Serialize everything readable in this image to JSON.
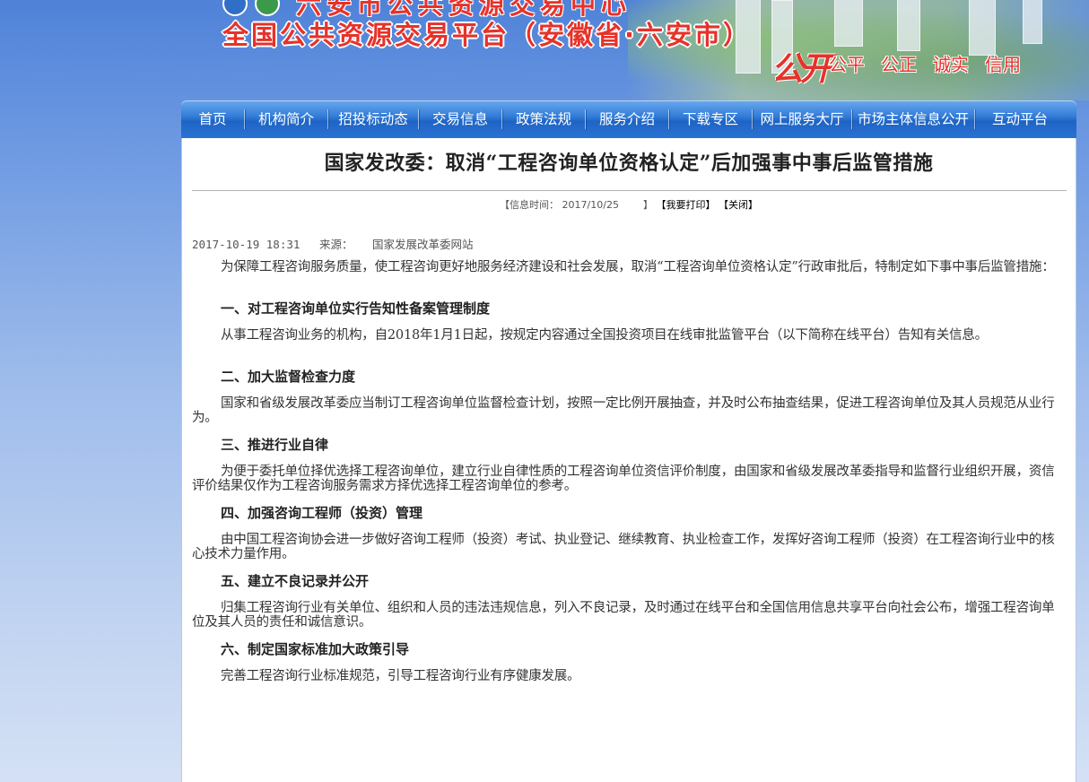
{
  "banner": {
    "top_title": "六安市公共资源交易中心",
    "title": "全国公共资源交易平台（安徽省·六安市）",
    "logo_text": "公开",
    "slogans": [
      "公平",
      "公正",
      "诚实",
      "信用"
    ]
  },
  "nav": {
    "items": [
      "首页",
      "机构简介",
      "招投标动态",
      "交易信息",
      "政策法规",
      "服务介绍",
      "下载专区",
      "网上服务大厅",
      "市场主体信息公开",
      "互动平台"
    ]
  },
  "article": {
    "title": "国家发改委：取消“工程咨询单位资格认定”后加强事中事后监管措施",
    "meta_label": "【信息时间：",
    "meta_date": "2017/10/25",
    "meta_close_bracket": "】",
    "print_link": "【我要打印】",
    "close_link": "【关闭】",
    "byline_datetime": "2017-10-19 18:31",
    "byline_source_label": "来源：",
    "byline_source": "国家发展改革委网站",
    "intro": "为保障工程咨询服务质量，使工程咨询更好地服务经济建设和社会发展，取消“工程咨询单位资格认定”行政审批后，特制定如下事中事后监管措施：",
    "sections": [
      {
        "heading": "一、对工程咨询单位实行告知性备案管理制度",
        "text": "从事工程咨询业务的机构，自2018年1月1日起，按规定内容通过全国投资项目在线审批监管平台（以下简称在线平台）告知有关信息。"
      },
      {
        "heading": "二、加大监督检查力度",
        "text": "国家和省级发展改革委应当制订工程咨询单位监督检查计划，按照一定比例开展抽查，并及时公布抽查结果，促进工程咨询单位及其人员规范从业行为。"
      },
      {
        "heading": "三、推进行业自律",
        "text": "为便于委托单位择优选择工程咨询单位，建立行业自律性质的工程咨询单位资信评价制度，由国家和省级发展改革委指导和监督行业组织开展，资信评价结果仅作为工程咨询服务需求方择优选择工程咨询单位的参考。"
      },
      {
        "heading": "四、加强咨询工程师（投资）管理",
        "text": "由中国工程咨询协会进一步做好咨询工程师（投资）考试、执业登记、继续教育、执业检查工作，发挥好咨询工程师（投资）在工程咨询行业中的核心技术力量作用。"
      },
      {
        "heading": "五、建立不良记录并公开",
        "text": "归集工程咨询行业有关单位、组织和人员的违法违规信息，列入不良记录，及时通过在线平台和全国信用信息共享平台向社会公布，增强工程咨询单位及其人员的责任和诚信意识。"
      },
      {
        "heading": "六、制定国家标准加大政策引导",
        "text": "完善工程咨询行业标准规范，引导工程咨询行业有序健康发展。"
      }
    ]
  },
  "colors": {
    "background_top": "#4f82d8",
    "nav_blue": "#2f79d6",
    "banner_red": "#e6322a",
    "panel_bg": "#ffffff"
  }
}
